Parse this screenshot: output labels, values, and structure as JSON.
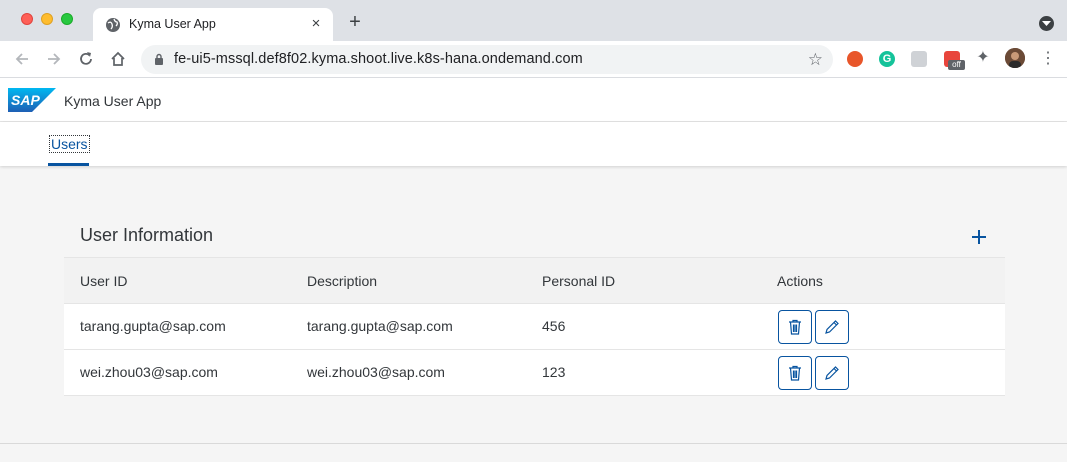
{
  "browser": {
    "tab_title": "Kyma User App",
    "new_tab": "+",
    "tab_close": "×",
    "url": "fe-ui5-mssql.def8f02.kyma.shoot.live.k8s-hana.ondemand.com",
    "star": "☆",
    "ext_badge": "off",
    "menu": "⋮"
  },
  "shellbar": {
    "logo_text": "SAP",
    "app_title": "Kyma User App"
  },
  "tabs": [
    {
      "label": "Users"
    }
  ],
  "card": {
    "title": "User Information",
    "add_label": "+"
  },
  "table": {
    "columns": [
      "User ID",
      "Description",
      "Personal ID",
      "Actions"
    ],
    "rows": [
      {
        "user_id": "tarang.gupta@sap.com",
        "description": "tarang.gupta@sap.com",
        "personal_id": "456"
      },
      {
        "user_id": "wei.zhou03@sap.com",
        "description": "wei.zhou03@sap.com",
        "personal_id": "123"
      }
    ]
  },
  "colors": {
    "accent": "#0854a0",
    "shell_bg": "#ffffff",
    "page_bg": "#f5f5f5"
  },
  "icons": {
    "row_actions": [
      "delete-icon",
      "edit-icon"
    ],
    "header": [
      "add-icon"
    ]
  }
}
